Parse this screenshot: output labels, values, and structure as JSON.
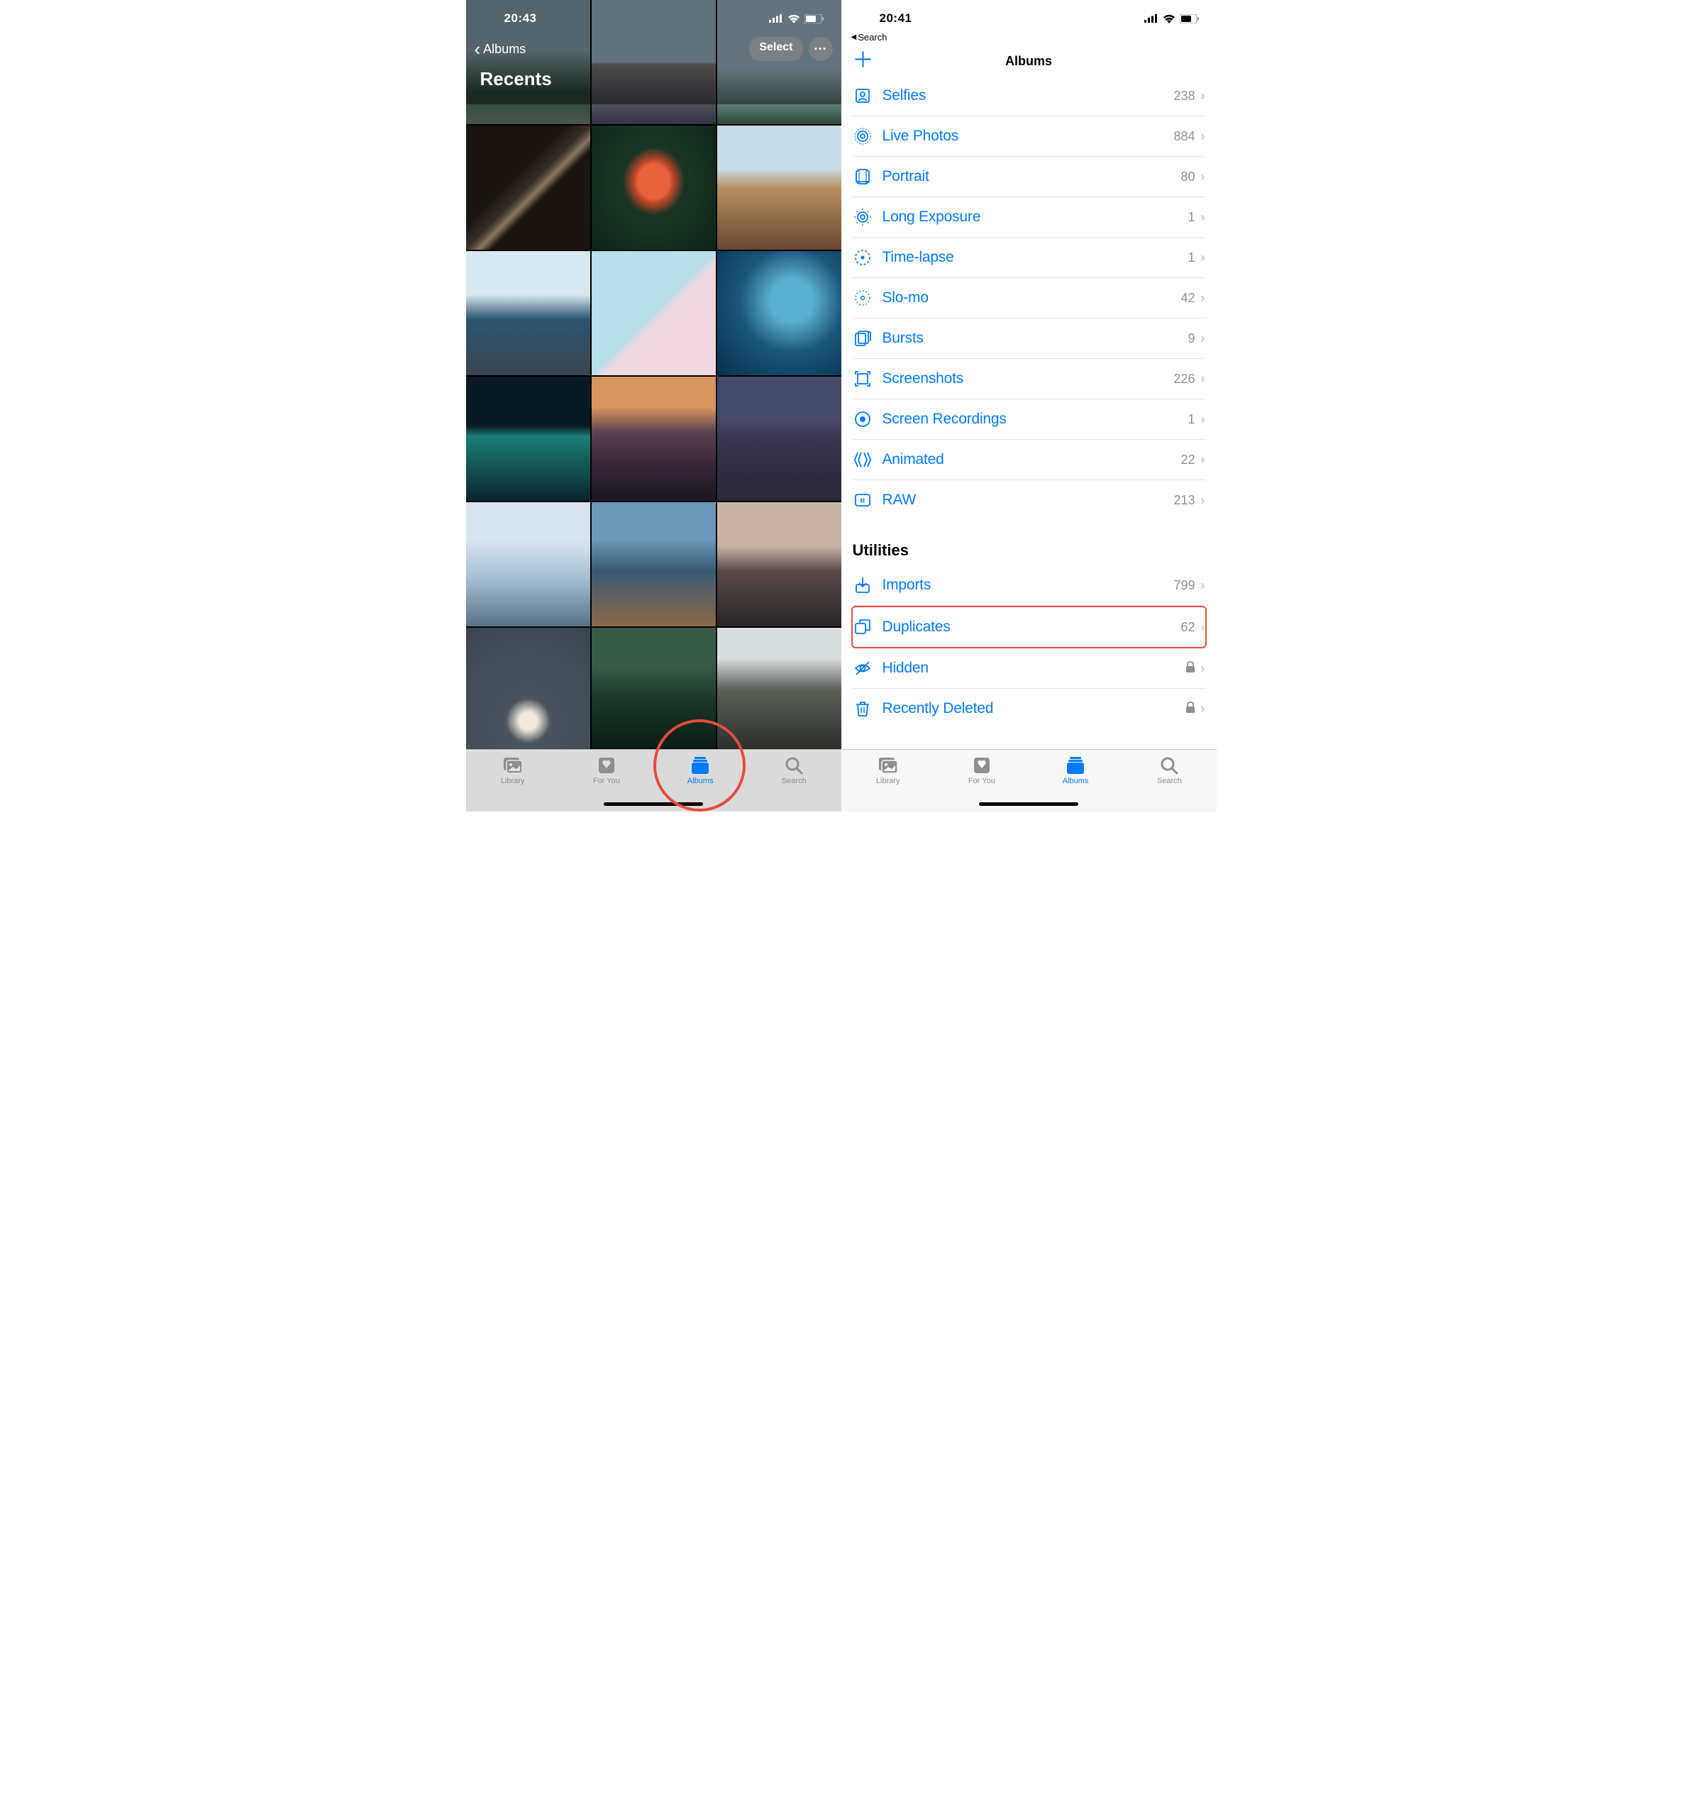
{
  "left": {
    "time": "20:43",
    "back_label": "Albums",
    "title": "Recents",
    "select_btn": "Select",
    "tabs": {
      "library": "Library",
      "foryou": "For You",
      "albums": "Albums",
      "search": "Search"
    }
  },
  "right": {
    "time": "20:41",
    "breadcrumb": "Search",
    "title": "Albums",
    "media_types": [
      {
        "icon": "selfies",
        "label": "Selfies",
        "count": "238"
      },
      {
        "icon": "live",
        "label": "Live Photos",
        "count": "884"
      },
      {
        "icon": "portrait",
        "label": "Portrait",
        "count": "80"
      },
      {
        "icon": "longexp",
        "label": "Long Exposure",
        "count": "1"
      },
      {
        "icon": "timelapse",
        "label": "Time-lapse",
        "count": "1"
      },
      {
        "icon": "slomo",
        "label": "Slo-mo",
        "count": "42"
      },
      {
        "icon": "bursts",
        "label": "Bursts",
        "count": "9"
      },
      {
        "icon": "screenshot",
        "label": "Screenshots",
        "count": "226"
      },
      {
        "icon": "recording",
        "label": "Screen Recordings",
        "count": "1"
      },
      {
        "icon": "animated",
        "label": "Animated",
        "count": "22"
      },
      {
        "icon": "raw",
        "label": "RAW",
        "count": "213"
      }
    ],
    "utilities_header": "Utilities",
    "utilities": [
      {
        "icon": "imports",
        "label": "Imports",
        "count": "799"
      },
      {
        "icon": "duplicates",
        "label": "Duplicates",
        "count": "62",
        "highlighted": true
      },
      {
        "icon": "hidden",
        "label": "Hidden",
        "locked": true
      },
      {
        "icon": "trash",
        "label": "Recently Deleted",
        "locked": true
      }
    ],
    "tabs": {
      "library": "Library",
      "foryou": "For You",
      "albums": "Albums",
      "search": "Search"
    }
  }
}
